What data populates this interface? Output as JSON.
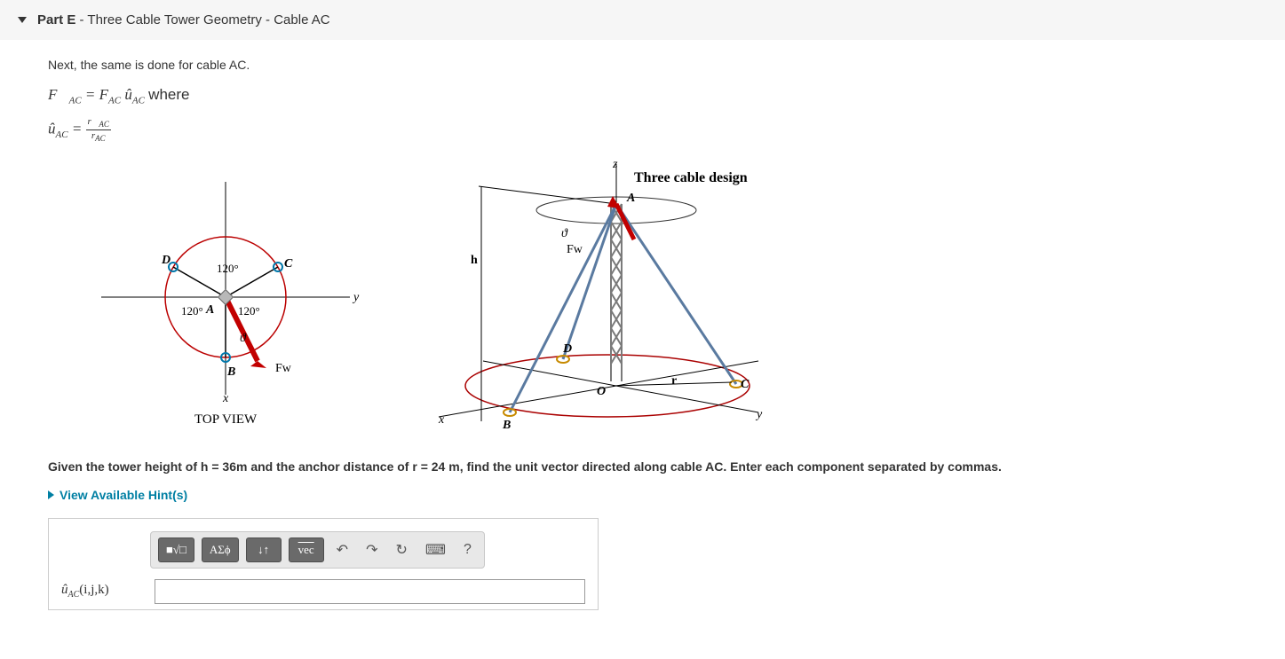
{
  "header": {
    "part_label": "Part E",
    "separator": " - ",
    "title": "Three Cable Tower Geometry - Cable AC"
  },
  "intro": "Next, the same is done for cable AC.",
  "formula1": {
    "lhs_vec": "F⃗",
    "lhs_sub": "AC",
    "eq": " = ",
    "rhs_F": "F",
    "rhs_sub1": "AC",
    "rhs_u": "û",
    "rhs_sub2": "AC",
    "where": " where"
  },
  "formula2": {
    "lhs_u": "û",
    "lhs_sub": "AC",
    "eq": " = ",
    "num_r": "r⃗",
    "num_sub": "AC",
    "den_r": "r",
    "den_sub": "AC"
  },
  "topview": {
    "title": "TOP VIEW",
    "labels": {
      "D": "D",
      "C": "C",
      "A": "A",
      "B": "B",
      "x": "x",
      "y": "y",
      "theta": "ϑ",
      "Fw": "Fw",
      "a120_1": "120°",
      "a120_2": "120°",
      "a120_3": "120°"
    }
  },
  "iso": {
    "title": "Three cable design",
    "labels": {
      "z": "z",
      "h": "h",
      "theta": "ϑ",
      "Fw": "Fw",
      "A": "A",
      "D": "D",
      "O": "O",
      "r": "r",
      "C": "C",
      "B": "B",
      "x": "x",
      "y": "y"
    }
  },
  "given": {
    "prefix": "Given the tower height of h =  ",
    "h": "36m",
    "mid": " and the anchor distance of r =  ",
    "r": "24 m",
    "suffix": ", find the  unit vector directed along cable AC. Enter each component separated by commas."
  },
  "hints_label": "View Available Hint(s)",
  "toolbar": {
    "templates": "■√□",
    "greek": "ΑΣϕ",
    "subsuper": "↓↑",
    "vec": "vec",
    "undo": "↶",
    "redo": "↷",
    "reset": "↻",
    "keyboard": "⌨",
    "help": "?"
  },
  "answer": {
    "label_u": "û",
    "label_sub": "AC",
    "label_ijk": "(i,j,k)",
    "value": ""
  }
}
